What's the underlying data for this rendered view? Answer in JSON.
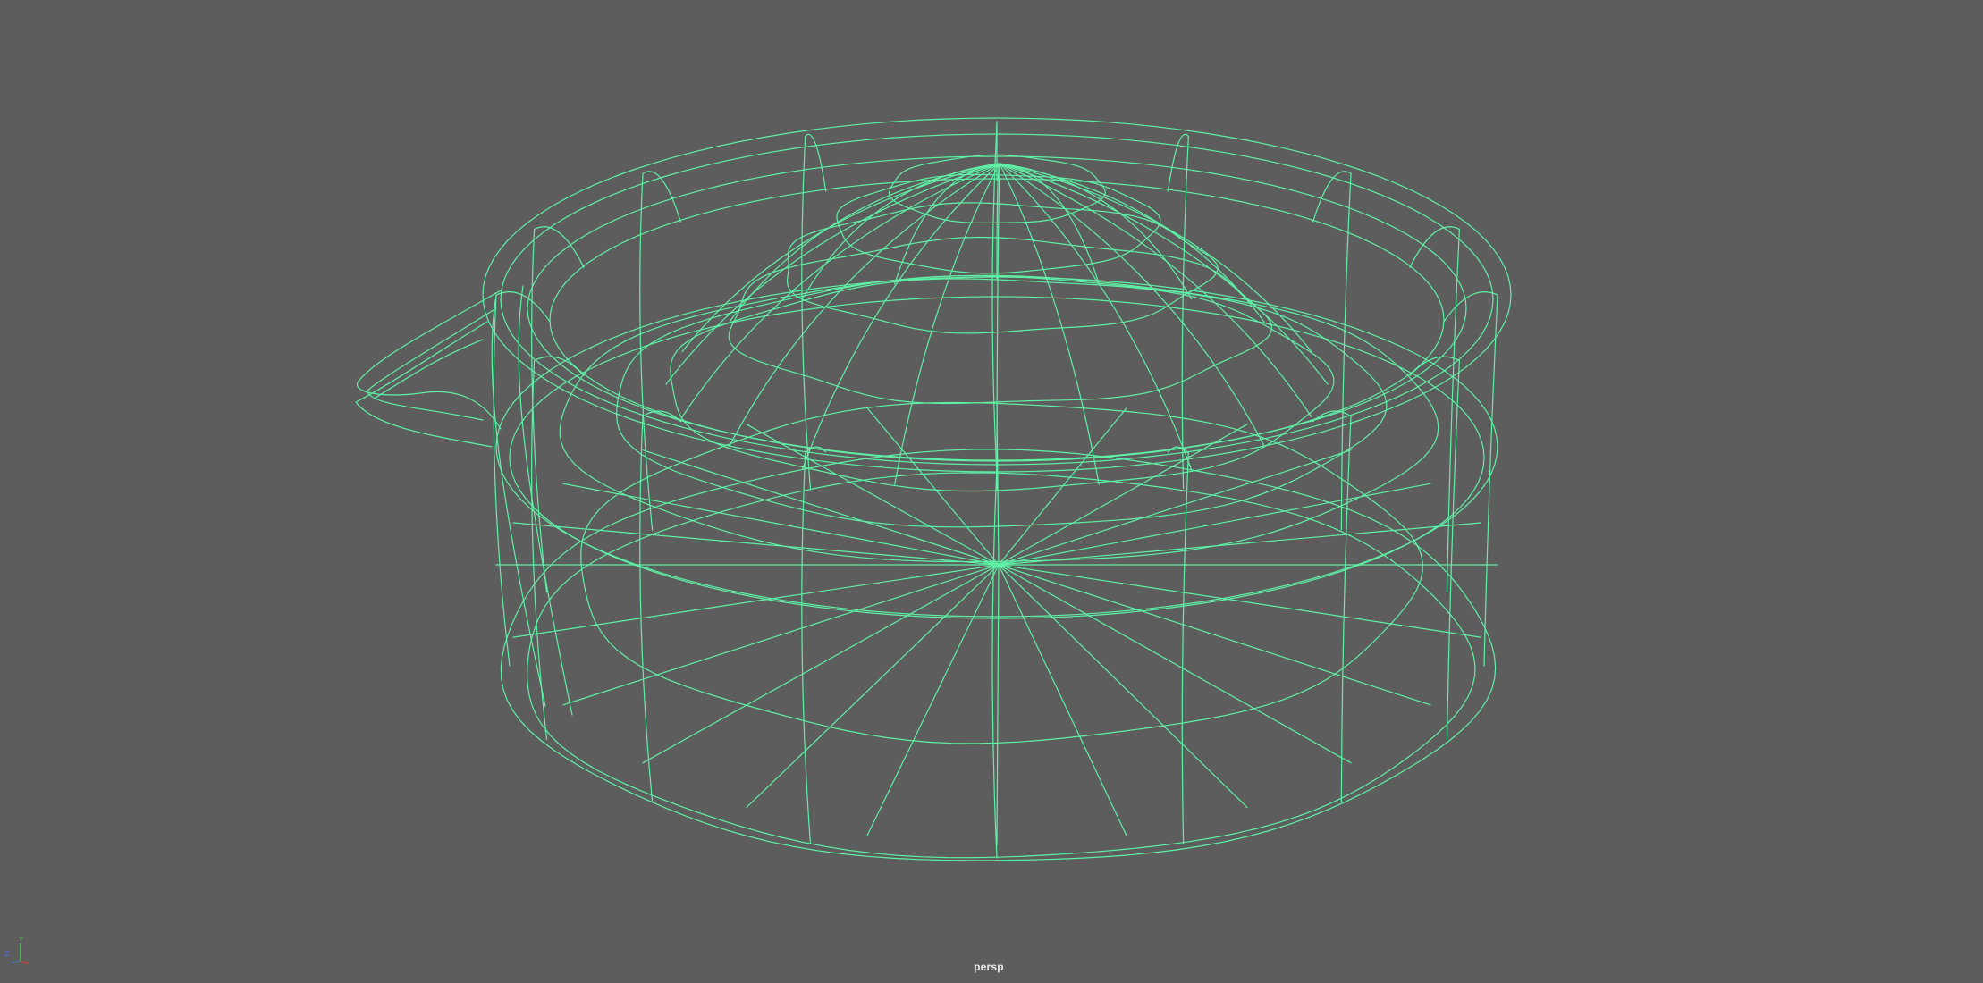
{
  "viewport": {
    "camera_label": "persp",
    "background_color": "#5d5d5d",
    "wireframe_color": "#5ff0a6",
    "display_mode": "wireframe",
    "object": "juicer"
  },
  "axis_gizmo": {
    "labels": [
      "Y",
      "Z"
    ],
    "colors": {
      "x": "#e03a3a",
      "y": "#46d046",
      "z": "#4a6cf0"
    }
  }
}
